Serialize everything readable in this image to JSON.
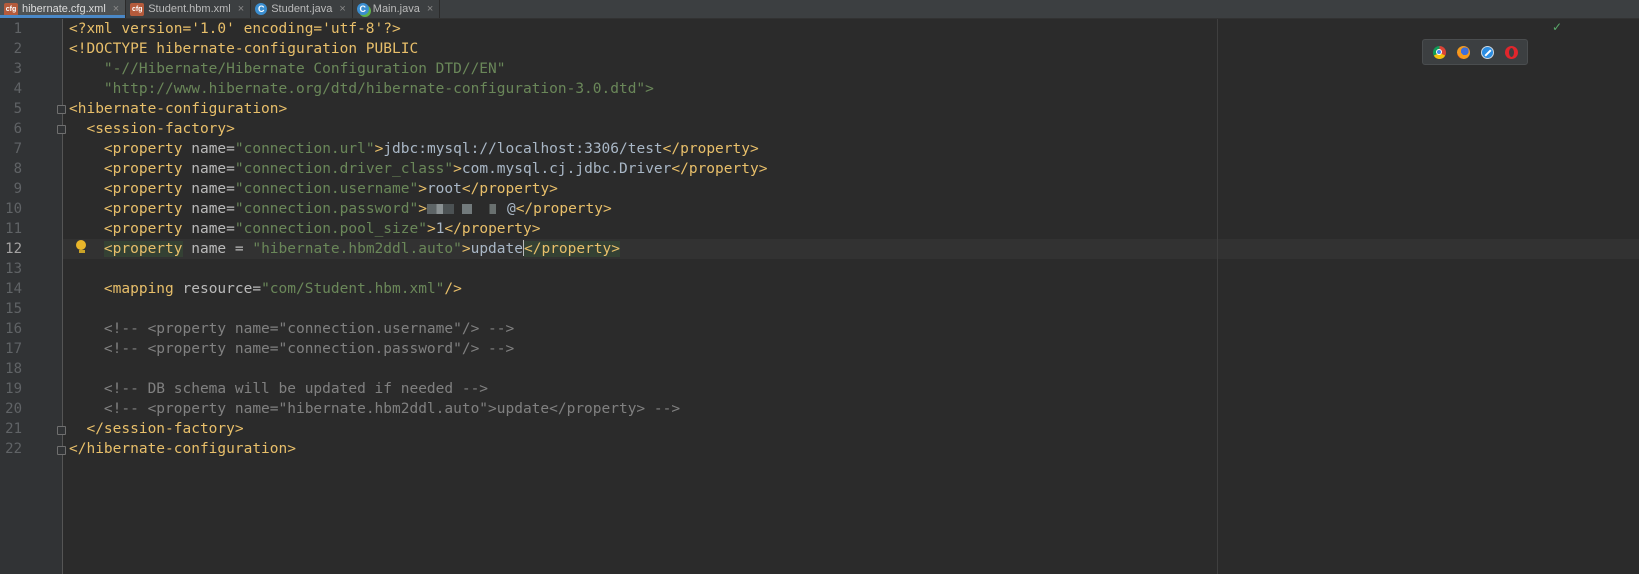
{
  "tabs": [
    {
      "label": "hibernate.cfg.xml",
      "icon": "xml-file-icon",
      "active": true
    },
    {
      "label": "Student.hbm.xml",
      "icon": "xml-file-icon",
      "active": false
    },
    {
      "label": "Student.java",
      "icon": "java-class-icon",
      "active": false
    },
    {
      "label": "Main.java",
      "icon": "java-main-class-icon",
      "active": false
    }
  ],
  "tab_close_glyph": "×",
  "current_line": 12,
  "line_numbers": [
    "1",
    "2",
    "3",
    "4",
    "5",
    "6",
    "7",
    "8",
    "9",
    "10",
    "11",
    "12",
    "13",
    "14",
    "15",
    "16",
    "17",
    "18",
    "19",
    "20",
    "21",
    "22"
  ],
  "code": {
    "l1_decl": "<?xml version='1.0' encoding='utf-8'?>",
    "l2_doctype": "<!DOCTYPE hibernate-configuration PUBLIC",
    "l3_public_id": "\"-//Hibernate/Hibernate Configuration DTD//EN\"",
    "l4_system_id": "\"http://www.hibernate.org/dtd/hibernate-configuration-3.0.dtd\">",
    "l5_open": "<hibernate-configuration>",
    "l6_open": "<session-factory>",
    "prop_open": "<property",
    "prop_close": "</property>",
    "name_attr": "name",
    "l7_name": "\"connection.url\"",
    "l7_value": "jdbc:mysql://localhost:3306/test",
    "l8_name": "\"connection.driver_class\"",
    "l8_value": "com.mysql.cj.jdbc.Driver",
    "l9_name": "\"connection.username\"",
    "l9_value": "root",
    "l10_name": "\"connection.password\"",
    "l10_value": "@",
    "l11_name": "\"connection.pool_size\"",
    "l11_value": "1",
    "l12_name_spaced": "name = ",
    "l12_name": "\"hibernate.hbm2ddl.auto\"",
    "l12_value": "update",
    "l14_mapping_open": "<mapping",
    "l14_attr": "resource",
    "l14_value": "\"com/Student.hbm.xml\"",
    "l14_close": "/>",
    "l16_comment": "<!-- <property name=\"connection.username\"/> -->",
    "l17_comment": "<!-- <property name=\"connection.password\"/> -->",
    "l19_comment": "<!-- DB schema will be updated if needed -->",
    "l20_comment": "<!-- <property name=\"hibernate.hbm2ddl.auto\">update</property> -->",
    "l21_close": "</session-factory>",
    "l22_close": "</hibernate-configuration>"
  },
  "browser_popup": [
    "chrome-icon",
    "firefox-icon",
    "safari-icon",
    "opera-icon"
  ],
  "inspection_status": "✓",
  "colors": {
    "background": "#2b2b2b",
    "tag": "#e8bf6a",
    "attr_value": "#6a8759",
    "comment": "#808080",
    "text": "#a9b7c6",
    "active_tab_underline": "#4a88c7"
  }
}
